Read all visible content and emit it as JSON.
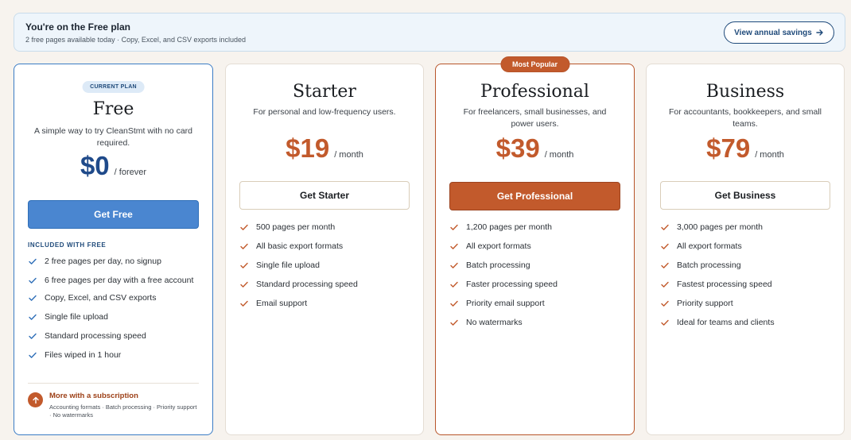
{
  "banner": {
    "title": "You're on the Free plan",
    "subtitle": "2 free pages available today · Copy, Excel, and CSV exports included",
    "button_label": "View annual savings"
  },
  "plans": [
    {
      "badge": "CURRENT PLAN",
      "name": "Free",
      "description": "A simple way to try CleanStmt with no card required.",
      "price": "$0",
      "period": "/ forever",
      "cta": "Get Free",
      "included_heading": "INCLUDED WITH FREE",
      "features": [
        "2 free pages per day, no signup",
        "6 free pages per day with a free account",
        "Copy, Excel, and CSV exports",
        "Single file upload",
        "Standard processing speed",
        "Files wiped in 1 hour"
      ],
      "upsell_title": "More with a subscription",
      "upsell_text": "Accounting formats · Batch processing · Priority support · No watermarks"
    },
    {
      "name": "Starter",
      "description": "For personal and low-frequency users.",
      "price": "$19",
      "period": "/ month",
      "cta": "Get Starter",
      "features": [
        "500 pages per month",
        "All basic export formats",
        "Single file upload",
        "Standard processing speed",
        "Email support"
      ]
    },
    {
      "badge": "Most Popular",
      "name": "Professional",
      "description": "For freelancers, small businesses, and power users.",
      "price": "$39",
      "period": "/ month",
      "cta": "Get Professional",
      "features": [
        "1,200 pages per month",
        "All export formats",
        "Batch processing",
        "Faster processing speed",
        "Priority email support",
        "No watermarks"
      ]
    },
    {
      "name": "Business",
      "description": "For accountants, bookkeepers, and small teams.",
      "price": "$79",
      "period": "/ month",
      "cta": "Get Business",
      "features": [
        "3,000 pages per month",
        "All export formats",
        "Batch processing",
        "Fastest processing speed",
        "Priority support",
        "Ideal for teams and clients"
      ]
    }
  ],
  "colors": {
    "free_accent": "#3a7cc5",
    "paid_accent": "#c25a2c",
    "background": "#f7f3ee"
  },
  "icons": [
    "arrow-right-icon",
    "check-icon",
    "arrow-up-icon"
  ]
}
